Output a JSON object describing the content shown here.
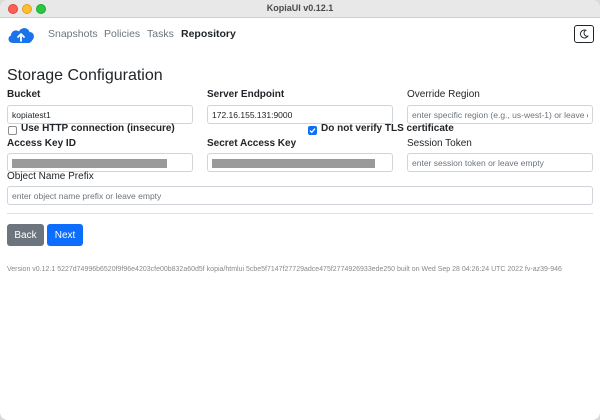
{
  "window": {
    "title": "KopiaUI v0.12.1"
  },
  "nav": {
    "items": [
      {
        "label": "Snapshots",
        "active": false
      },
      {
        "label": "Policies",
        "active": false
      },
      {
        "label": "Tasks",
        "active": false
      },
      {
        "label": "Repository",
        "active": true
      }
    ],
    "theme_icon": "moon-icon"
  },
  "page": {
    "title": "Storage Configuration"
  },
  "form": {
    "bucket": {
      "label": "Bucket",
      "value": "kopiatest1"
    },
    "server_endpoint": {
      "label": "Server Endpoint",
      "value": "172.16.155.131:9000"
    },
    "override_region": {
      "label": "Override Region",
      "placeholder": "enter specific region (e.g., us-west-1) or leave empty"
    },
    "use_http": {
      "label": "Use HTTP connection (insecure)",
      "checked": false
    },
    "no_verify_tls": {
      "label": "Do not verify TLS certificate",
      "checked": true
    },
    "access_key_id": {
      "label": "Access Key ID",
      "value_redacted": true
    },
    "secret_access_key": {
      "label": "Secret Access Key",
      "value_redacted": true
    },
    "session_token": {
      "label": "Session Token",
      "placeholder": "enter session token or leave empty"
    },
    "object_name_prefix": {
      "label": "Object Name Prefix",
      "placeholder": "enter object name prefix or leave empty"
    }
  },
  "buttons": {
    "back": "Back",
    "next": "Next"
  },
  "footer": {
    "version_text": "Version v0.12.1 5227d74996b6520f9f96e4203cfe00b832a60d5f kopia/htmlui 5cbe5f7147f27729adce475f2774926933ede250 built on Wed Sep 28 04:26:24 UTC 2022 fv-az39-946"
  },
  "colors": {
    "accent": "#0d6efd",
    "secondary": "#6c757d",
    "logo": "#1a73e8"
  }
}
